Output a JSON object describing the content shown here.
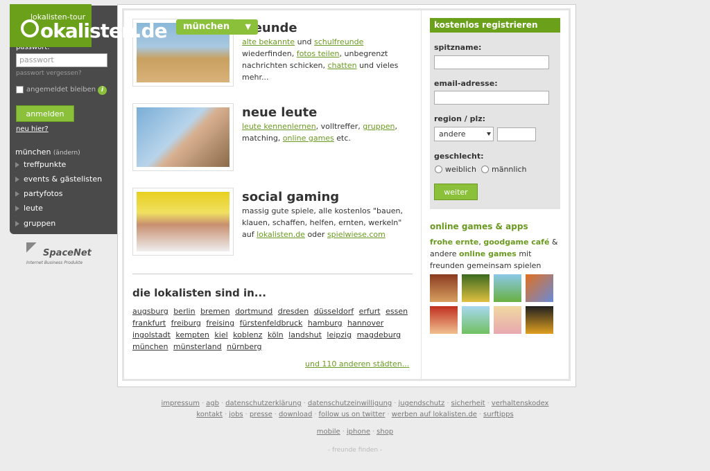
{
  "header": {
    "logo_tour": "lokalisten-tour",
    "logo_word": "okalisten.de",
    "city_selector": "münchen"
  },
  "sidebar": {
    "password_label": "passwort:",
    "password_placeholder": "passwort",
    "forgot_password": "passwort vergessen?",
    "remember_label": "angemeldet bleiben",
    "info_glyph": "i",
    "login_button": "anmelden",
    "new_here": "neu hier?",
    "city": "münchen",
    "change_city": "(ändern)",
    "nav": [
      {
        "label": "treffpunkte"
      },
      {
        "label": "events & gästelisten"
      },
      {
        "label": "partyfotos"
      },
      {
        "label": "leute"
      },
      {
        "label": "gruppen"
      }
    ],
    "sponsor_name": "SpaceNet",
    "sponsor_tagline": "Internet Business Produkte"
  },
  "features": [
    {
      "title": "freunde",
      "text": [
        {
          "link": "alte bekannte"
        },
        {
          "plain": " und "
        },
        {
          "link": "schulfreunde"
        },
        {
          "plain": " wiederfinden, "
        },
        {
          "link": "fotos teilen"
        },
        {
          "plain": ", unbegrenzt nachrichten schicken, "
        },
        {
          "link": "chatten"
        },
        {
          "plain": " und vieles mehr..."
        }
      ]
    },
    {
      "title": "neue leute",
      "text": [
        {
          "link": "leute kennenlernen"
        },
        {
          "plain": ", volltreffer, "
        },
        {
          "link": "gruppen"
        },
        {
          "plain": ", matching, "
        },
        {
          "link": "online games"
        },
        {
          "plain": " etc."
        }
      ]
    },
    {
      "title": "social gaming",
      "text": [
        {
          "plain": "massig gute spiele, alle kostenlos \"bauen, klauen, schaffen, helfen, ernten, werkeln\" auf "
        },
        {
          "link": "lokalisten.de"
        },
        {
          "plain": " oder "
        },
        {
          "link": "spielwiese.com"
        }
      ]
    }
  ],
  "cities": {
    "title": "die lokalisten sind in...",
    "list": [
      "augsburg",
      "berlin",
      "bremen",
      "dortmund",
      "dresden",
      "düsseldorf",
      "erfurt",
      "essen",
      "frankfurt",
      "freiburg",
      "freising",
      "fürstenfeldbruck",
      "hamburg",
      "hannover",
      "ingolstadt",
      "kempten",
      "kiel",
      "koblenz",
      "köln",
      "landshut",
      "leipzig",
      "magdeburg",
      "münchen",
      "münsterland",
      "nürnberg"
    ],
    "more": "und 110 anderen städten..."
  },
  "register": {
    "title": "kostenlos registrieren",
    "nickname_label": "spitzname:",
    "email_label": "email-adresse:",
    "region_label": "region / plz:",
    "region_value": "andere",
    "gender_label": "geschlecht:",
    "gender_female": "weiblich",
    "gender_male": "männlich",
    "submit": "weiter"
  },
  "games": {
    "title": "online games & apps",
    "game1": "frohe ernte",
    "comma": ", ",
    "game2": "goodgame café",
    "and_other": " & andere ",
    "online_games": "online games",
    "tail": " mit freunden gemeinsam spielen"
  },
  "footer": {
    "row1": [
      "impressum",
      "agb",
      "datenschutzerklärung",
      "datenschutzeinwilligung",
      "jugendschutz",
      "sicherheit",
      "verhaltenskodex"
    ],
    "row2": [
      "kontakt",
      "jobs",
      "presse",
      "download",
      "follow us on twitter",
      "werben auf lokalisten.de",
      "surftipps"
    ],
    "row3": [
      "mobile",
      "iphone",
      "shop"
    ],
    "bottom": "- freunde finden -"
  },
  "colors": {
    "brand_green": "#6aa01a",
    "button_green": "#8ac03a",
    "sidebar_dark": "#4a4a4a"
  }
}
